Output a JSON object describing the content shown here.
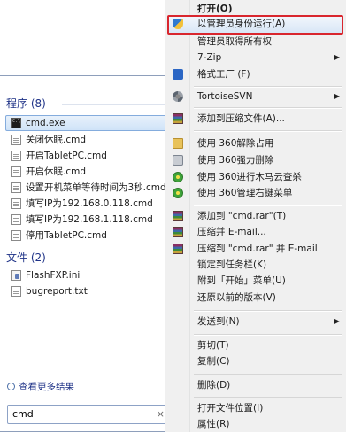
{
  "start_menu": {
    "programs_header": "程序 (8)",
    "programs": [
      {
        "label": "cmd.exe",
        "icon": "cmd-icon",
        "selected": true
      },
      {
        "label": "关闭休眠.cmd",
        "icon": "cmd-file-icon"
      },
      {
        "label": "开启TabletPC.cmd",
        "icon": "cmd-file-icon"
      },
      {
        "label": "开启休眠.cmd",
        "icon": "cmd-file-icon"
      },
      {
        "label": "设置开机菜单等待时间为3秒.cmd",
        "icon": "cmd-file-icon"
      },
      {
        "label": "填写IP为192.168.0.118.cmd",
        "icon": "cmd-file-icon"
      },
      {
        "label": "填写IP为192.168.1.118.cmd",
        "icon": "cmd-file-icon"
      },
      {
        "label": "停用TabletPC.cmd",
        "icon": "cmd-file-icon"
      }
    ],
    "files_header": "文件 (2)",
    "files": [
      {
        "label": "FlashFXP.ini",
        "icon": "ini-file-icon"
      },
      {
        "label": "bugreport.txt",
        "icon": "text-file-icon"
      }
    ],
    "see_more": "查看更多结果",
    "search_value": "cmd",
    "search_clear": "×"
  },
  "context_menu": {
    "items": [
      {
        "label": "打开(O)",
        "bold": true
      },
      {
        "label": "以管理员身份运行(A)",
        "icon": "uac-shield-icon",
        "highlighted": true
      },
      {
        "label": "管理员取得所有权"
      },
      {
        "label": "7-Zip",
        "submenu": true
      },
      {
        "label": "格式工厂 (F)",
        "icon": "format-factory-icon"
      },
      {
        "label": "TortoiseSVN",
        "icon": "tortoisesvn-icon",
        "submenu": true
      },
      {
        "label": "添加到压缩文件(A)...",
        "icon": "winrar-icon"
      },
      {
        "label": "使用 360解除占用",
        "icon": "folder-icon"
      },
      {
        "label": "使用 360强力删除",
        "icon": "disk-icon"
      },
      {
        "label": "使用 360进行木马云查杀",
        "icon": "360-icon"
      },
      {
        "label": "使用 360管理右键菜单",
        "icon": "360-icon"
      },
      {
        "label": "添加到 \"cmd.rar\"(T)",
        "icon": "winrar-icon"
      },
      {
        "label": "压缩并 E-mail...",
        "icon": "winrar-icon"
      },
      {
        "label": "压缩到 \"cmd.rar\" 并 E-mail",
        "icon": "winrar-icon"
      },
      {
        "label": "锁定到任务栏(K)"
      },
      {
        "label": "附到「开始」菜单(U)"
      },
      {
        "label": "还原以前的版本(V)"
      },
      {
        "label": "发送到(N)",
        "submenu": true
      },
      {
        "label": "剪切(T)"
      },
      {
        "label": "复制(C)"
      },
      {
        "label": "删除(D)"
      },
      {
        "label": "打开文件位置(I)"
      },
      {
        "label": "属性(R)"
      }
    ],
    "submenu_arrow": "▶"
  },
  "colors": {
    "highlight_border": "#d9262e",
    "selection_fill": "#cfe3f8",
    "menu_background": "#f0f0f0",
    "group_header_text": "#1e3287"
  }
}
